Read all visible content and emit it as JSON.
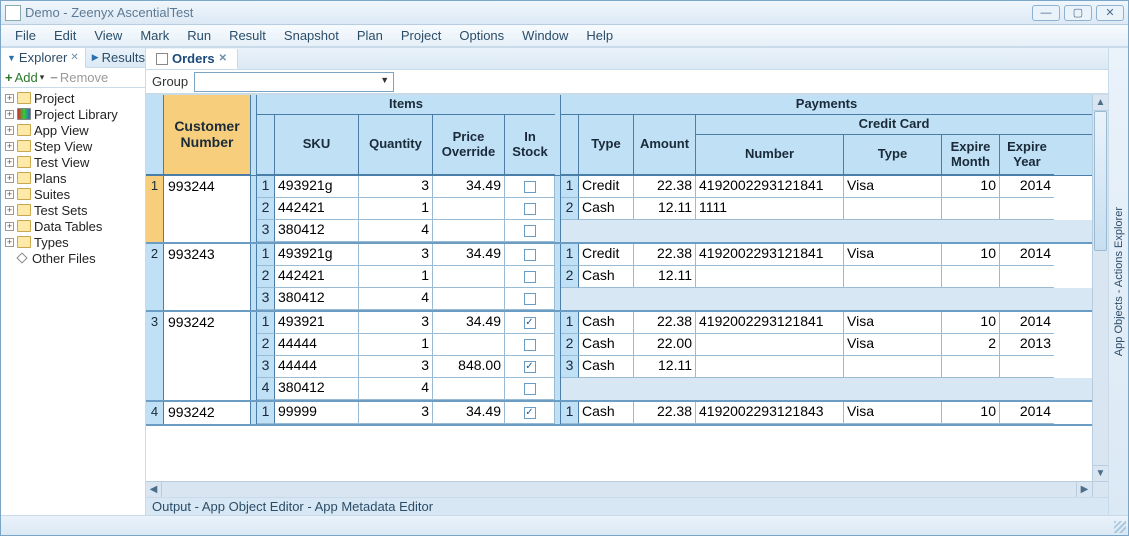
{
  "window": {
    "title": "Demo - Zeenyx AscentialTest"
  },
  "menu": [
    "File",
    "Edit",
    "View",
    "Mark",
    "Run",
    "Result",
    "Snapshot",
    "Plan",
    "Project",
    "Options",
    "Window",
    "Help"
  ],
  "left_tabs": {
    "explorer": "Explorer",
    "results": "Results"
  },
  "left_toolbar": {
    "add": "Add",
    "remove": "Remove"
  },
  "tree": [
    "Project",
    "Project Library",
    "App View",
    "Step View",
    "Test View",
    "Plans",
    "Suites",
    "Test Sets",
    "Data Tables",
    "Types",
    "Other Files"
  ],
  "center_tab": "Orders",
  "group_label": "Group",
  "right_panel": "App Objects - Actions Explorer",
  "bottom_bar": "Output - App Object Editor - App Metadata Editor",
  "headers": {
    "customer": "Customer Number",
    "items": "Items",
    "payments": "Payments",
    "sku": "SKU",
    "qty": "Quantity",
    "po": "Price Override",
    "stock": "In Stock",
    "ptype": "Type",
    "amount": "Amount",
    "cc": "Credit Card",
    "ccnum": "Number",
    "cctype": "Type",
    "em": "Expire Month",
    "ey": "Expire Year"
  },
  "orders": [
    {
      "n": 1,
      "customer": "993244",
      "selected": true,
      "items": [
        {
          "n": 1,
          "sku": "493921g",
          "qty": "3",
          "po": "34.49",
          "stock": false
        },
        {
          "n": 2,
          "sku": "442421",
          "qty": "1",
          "po": "",
          "stock": false
        },
        {
          "n": 3,
          "sku": "380412",
          "qty": "4",
          "po": "",
          "stock": false
        }
      ],
      "payments": [
        {
          "n": 1,
          "type": "Credit",
          "amount": "22.38",
          "ccnum": "4192002293121841",
          "cctype": "Visa",
          "em": "10",
          "ey": "2014"
        },
        {
          "n": 2,
          "type": "Cash",
          "amount": "12.11",
          "ccnum": "1111",
          "cctype": "",
          "em": "",
          "ey": ""
        }
      ]
    },
    {
      "n": 2,
      "customer": "993243",
      "selected": false,
      "items": [
        {
          "n": 1,
          "sku": "493921g",
          "qty": "3",
          "po": "34.49",
          "stock": false
        },
        {
          "n": 2,
          "sku": "442421",
          "qty": "1",
          "po": "",
          "stock": false
        },
        {
          "n": 3,
          "sku": "380412",
          "qty": "4",
          "po": "",
          "stock": false
        }
      ],
      "payments": [
        {
          "n": 1,
          "type": "Credit",
          "amount": "22.38",
          "ccnum": "4192002293121841",
          "cctype": "Visa",
          "em": "10",
          "ey": "2014"
        },
        {
          "n": 2,
          "type": "Cash",
          "amount": "12.11",
          "ccnum": "",
          "cctype": "",
          "em": "",
          "ey": ""
        }
      ]
    },
    {
      "n": 3,
      "customer": "993242",
      "selected": false,
      "items": [
        {
          "n": 1,
          "sku": "493921",
          "qty": "3",
          "po": "34.49",
          "stock": true
        },
        {
          "n": 2,
          "sku": "44444",
          "qty": "1",
          "po": "",
          "stock": false
        },
        {
          "n": 3,
          "sku": "44444",
          "qty": "3",
          "po": "848.00",
          "stock": true
        },
        {
          "n": 4,
          "sku": "380412",
          "qty": "4",
          "po": "",
          "stock": false
        }
      ],
      "payments": [
        {
          "n": 1,
          "type": "Cash",
          "amount": "22.38",
          "ccnum": "4192002293121841",
          "cctype": "Visa",
          "em": "10",
          "ey": "2014"
        },
        {
          "n": 2,
          "type": "Cash",
          "amount": "22.00",
          "ccnum": "",
          "cctype": "Visa",
          "em": "2",
          "ey": "2013"
        },
        {
          "n": 3,
          "type": "Cash",
          "amount": "12.11",
          "ccnum": "",
          "cctype": "",
          "em": "",
          "ey": ""
        }
      ]
    },
    {
      "n": 4,
      "customer": "993242",
      "selected": false,
      "items": [
        {
          "n": 1,
          "sku": "99999",
          "qty": "3",
          "po": "34.49",
          "stock": true
        }
      ],
      "payments": [
        {
          "n": 1,
          "type": "Cash",
          "amount": "22.38",
          "ccnum": "4192002293121843",
          "cctype": "Visa",
          "em": "10",
          "ey": "2014"
        }
      ]
    }
  ]
}
